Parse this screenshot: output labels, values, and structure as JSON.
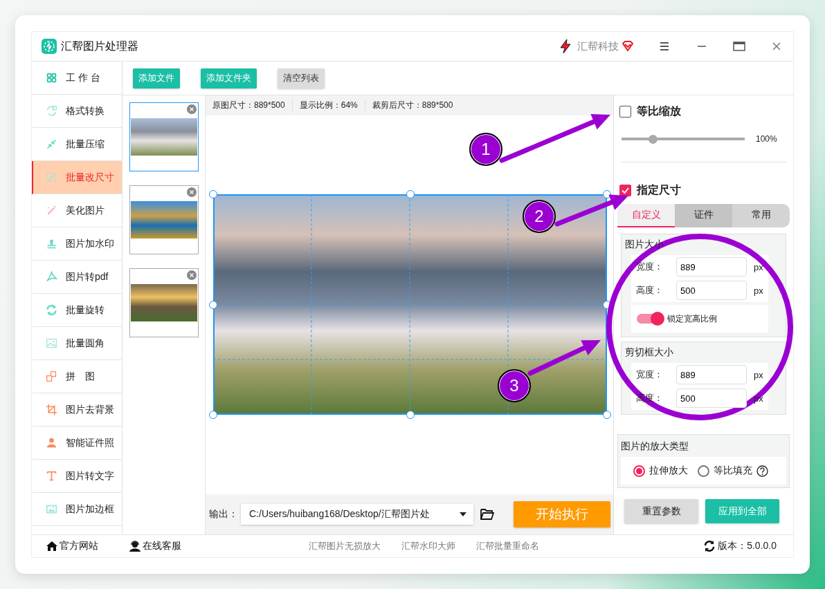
{
  "window": {
    "title": "汇帮图片处理器",
    "brand": "汇帮科技"
  },
  "sidebar": {
    "items": [
      {
        "label": "工 作 台",
        "selected": false
      },
      {
        "label": "格式转换",
        "selected": false
      },
      {
        "label": "批量压缩",
        "selected": false
      },
      {
        "label": "批量改尺寸",
        "selected": true
      },
      {
        "label": "美化图片",
        "selected": false
      },
      {
        "label": "图片加水印",
        "selected": false
      },
      {
        "label": "图片转pdf",
        "selected": false
      },
      {
        "label": "批量旋转",
        "selected": false
      },
      {
        "label": "批量圆角",
        "selected": false
      },
      {
        "label": "拼　图",
        "selected": false
      },
      {
        "label": "图片去背景",
        "selected": false
      },
      {
        "label": "智能证件照",
        "selected": false
      },
      {
        "label": "图片转文字",
        "selected": false
      },
      {
        "label": "图片加边框",
        "selected": false
      }
    ]
  },
  "toolbar": {
    "buttons": [
      {
        "label": "添加文件",
        "kind": "primary"
      },
      {
        "label": "添加文件夹",
        "kind": "primary"
      },
      {
        "label": "清空列表",
        "kind": "secondary"
      }
    ]
  },
  "thumbnails": [
    {
      "selected": true
    },
    {
      "selected": false
    },
    {
      "selected": false
    }
  ],
  "preview": {
    "info": [
      "原图尺寸：889*500",
      "显示比例：64%",
      "裁剪后尺寸：889*500"
    ]
  },
  "output": {
    "label": "输出：",
    "path": "C:/Users/huibang168/Desktop/汇帮图片处",
    "start_button": "开始执行"
  },
  "settings": {
    "proportional": {
      "label": "等比缩放",
      "checked": false,
      "level": 0.25,
      "reading": "100%"
    },
    "fixed_size": {
      "label": "指定尺寸",
      "checked": true
    },
    "tabs": [
      {
        "label": "自定义",
        "selected": true
      },
      {
        "label": "证件",
        "selected": false
      },
      {
        "label": "常用",
        "selected": false
      }
    ],
    "image_size": {
      "title": "图片大小",
      "fields": [
        {
          "label": "宽度：",
          "value": "889",
          "unit": "px"
        },
        {
          "label": "高度：",
          "value": "500",
          "unit": "px"
        }
      ],
      "lock": {
        "label": "锁定宽高比例",
        "on": true
      }
    },
    "crop_size": {
      "title": "剪切框大小",
      "fields": [
        {
          "label": "宽度：",
          "value": "889",
          "unit": "px"
        },
        {
          "label": "高度：",
          "value": "500",
          "unit": "px"
        }
      ]
    },
    "scale_type": {
      "title": "图片的放大类型",
      "options": [
        {
          "label": "拉伸放大",
          "selected": true
        },
        {
          "label": "等比填充",
          "selected": false
        }
      ]
    },
    "buttons": [
      {
        "label": "重置参数",
        "kind": "secondary"
      },
      {
        "label": "应用到全部",
        "kind": "primary"
      }
    ]
  },
  "footer": {
    "links": [
      "官方网站",
      "在线客服"
    ],
    "products": [
      "汇帮图片无损放大",
      "汇帮水印大师",
      "汇帮批量重命名"
    ],
    "version": "版本：5.0.0.0"
  },
  "annotations": {
    "markers": [
      "1",
      "2",
      "3"
    ]
  }
}
